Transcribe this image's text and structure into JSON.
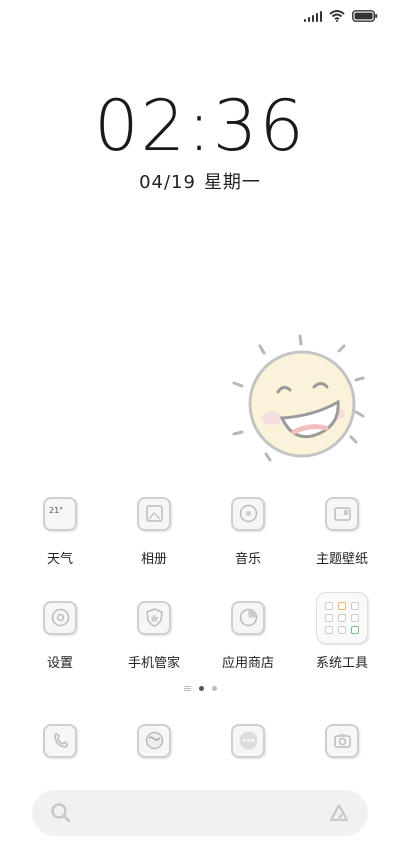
{
  "status_bar": {
    "icons": [
      "signal-icon",
      "wifi-icon",
      "battery-icon"
    ]
  },
  "clock": {
    "time": "02:36",
    "date": "04/19",
    "weekday": "星期一"
  },
  "apps": [
    {
      "label": "天气",
      "icon": "weather-icon",
      "badge": "21°"
    },
    {
      "label": "相册",
      "icon": "gallery-icon"
    },
    {
      "label": "音乐",
      "icon": "music-icon"
    },
    {
      "label": "主题壁纸",
      "icon": "themes-icon"
    },
    {
      "label": "设置",
      "icon": "settings-icon"
    },
    {
      "label": "手机管家",
      "icon": "security-icon"
    },
    {
      "label": "应用商店",
      "icon": "app-store-icon"
    },
    {
      "label": "系统工具",
      "icon": "system-tools-folder-icon"
    }
  ],
  "page_indicator": {
    "pages": 2,
    "active": 1
  },
  "dock": [
    {
      "icon": "phone-icon"
    },
    {
      "icon": "browser-icon"
    },
    {
      "icon": "messages-icon"
    },
    {
      "icon": "camera-icon"
    }
  ],
  "search_bar": {
    "left_icon": "search-icon",
    "right_icon": "assistant-icon"
  }
}
